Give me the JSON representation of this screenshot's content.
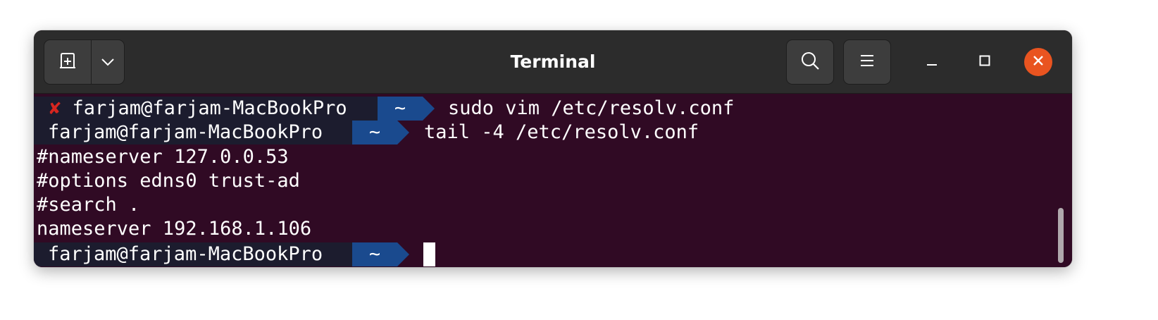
{
  "window": {
    "title": "Terminal"
  },
  "header": {
    "new_tab_icon": "new-tab-icon",
    "dropdown_icon": "chevron-down-icon",
    "search_icon": "search-icon",
    "menu_icon": "hamburger-menu-icon",
    "minimize_icon": "minimize-icon",
    "maximize_icon": "maximize-icon",
    "close_icon": "close-icon"
  },
  "colors": {
    "terminal_bg": "#300a24",
    "titlebar_bg": "#2c2c2c",
    "close_button": "#e95420",
    "prompt_host_bg": "#1c1c2e",
    "prompt_dir_bg": "#1a4a8e",
    "error_mark": "#d7261f"
  },
  "terminal": {
    "prompts": [
      {
        "status_mark": "✘",
        "user_host": "farjam@farjam-MacBookPro",
        "dir": "~",
        "command": "sudo vim /etc/resolv.conf"
      },
      {
        "status_mark": "",
        "user_host": "farjam@farjam-MacBookPro",
        "dir": "~",
        "command": "tail -4 /etc/resolv.conf"
      },
      {
        "status_mark": "",
        "user_host": "farjam@farjam-MacBookPro",
        "dir": "~",
        "command": ""
      }
    ],
    "output_lines": [
      "#nameserver 127.0.0.53",
      "#options edns0 trust-ad",
      "#search .",
      "nameserver 192.168.1.106"
    ]
  }
}
